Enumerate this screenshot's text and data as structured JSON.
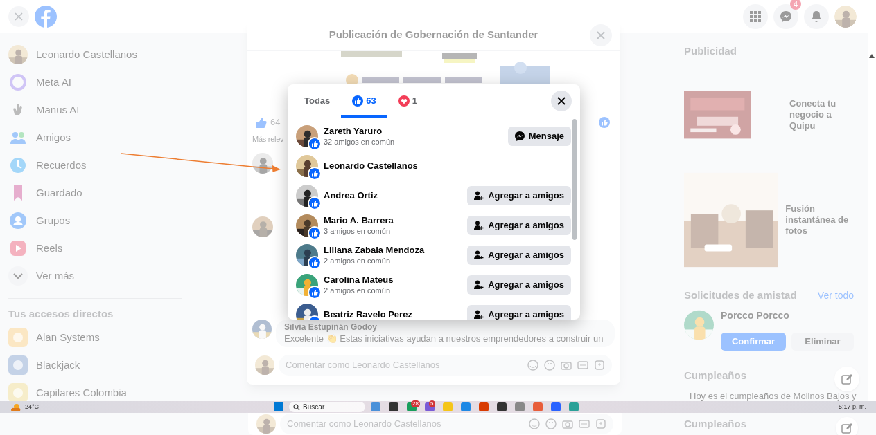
{
  "top_bar": {
    "messenger_badge": "4"
  },
  "sidebar": {
    "items": [
      {
        "kind": "profile",
        "label": "Leonardo Castellanos"
      },
      {
        "kind": "ring",
        "label": "Meta AI"
      },
      {
        "kind": "hand",
        "label": "Manus AI"
      },
      {
        "kind": "people",
        "label": "Amigos"
      },
      {
        "kind": "clock",
        "label": "Recuerdos"
      },
      {
        "kind": "bookmark",
        "label": "Guardado"
      },
      {
        "kind": "group",
        "label": "Grupos"
      },
      {
        "kind": "play",
        "label": "Reels"
      },
      {
        "kind": "more",
        "label": "Ver más"
      }
    ],
    "shortcuts_heading": "Tus accesos directos",
    "shortcuts": [
      {
        "label": "Alan Systems"
      },
      {
        "label": "Blackjack"
      },
      {
        "label": "Capilares Colombia"
      }
    ]
  },
  "post_dialog": {
    "title": "Publicación de Gobernación de Santander",
    "reaction_count": "64",
    "sort_label": "Más relev",
    "last_comment": {
      "author": "Silvia Estupiñán Godoy",
      "text": "Excelente 👏 Estas iniciativas ayudan a nuestros emprendedores a construir un"
    },
    "comment_placeholder": "Comentar como Leonardo Castellanos"
  },
  "reactions_dialog": {
    "tabs": [
      {
        "kind": "all",
        "label": "Todas",
        "selected": false
      },
      {
        "kind": "like",
        "label": "63",
        "selected": true
      },
      {
        "kind": "love",
        "label": "1",
        "selected": false
      }
    ],
    "people": [
      {
        "name": "Zareth Yaruro",
        "mutual": "32 amigos en común",
        "action": {
          "kind": "message",
          "label": "Mensaje"
        }
      },
      {
        "name": "Leonardo Castellanos"
      },
      {
        "name": "Andrea Ortiz",
        "action": {
          "kind": "add",
          "label": "Agregar a amigos"
        }
      },
      {
        "name": "Mario A. Barrera",
        "mutual": "3 amigos en común",
        "action": {
          "kind": "add",
          "label": "Agregar a amigos"
        }
      },
      {
        "name": "Liliana Zabala Mendoza",
        "mutual": "2 amigos en común",
        "action": {
          "kind": "add",
          "label": "Agregar a amigos"
        }
      },
      {
        "name": "Carolina Mateus",
        "mutual": "2 amigos en común",
        "action": {
          "kind": "add",
          "label": "Agregar a amigos"
        }
      },
      {
        "name": "Beatriz Ravelo Perez",
        "action": {
          "kind": "add",
          "label": "Agregar a amigos"
        }
      }
    ]
  },
  "right_column": {
    "ads_heading": "Publicidad",
    "ads": [
      {
        "title": "Conecta tu negocio a Quipu"
      },
      {
        "title": "Fusión instantánea de fotos"
      }
    ],
    "requests_heading": "Solicitudes de amistad",
    "see_all": "Ver todo",
    "request": {
      "name": "Porcco Porcco",
      "confirm": "Confirmar",
      "delete": "Eliminar"
    },
    "birthdays_heading": "Cumpleaños",
    "birthday_text": "Hoy es el cumpleaños de Molinos Bajos y"
  },
  "taskbar": {
    "weather": "24°C",
    "search_placeholder": "Buscar",
    "badges": [
      "28",
      "5"
    ],
    "clock": "5:17 p. m."
  },
  "lower_strip": {
    "comment_placeholder": "Comentar como Leonardo Castellanos",
    "heading": "Cumpleaños"
  }
}
